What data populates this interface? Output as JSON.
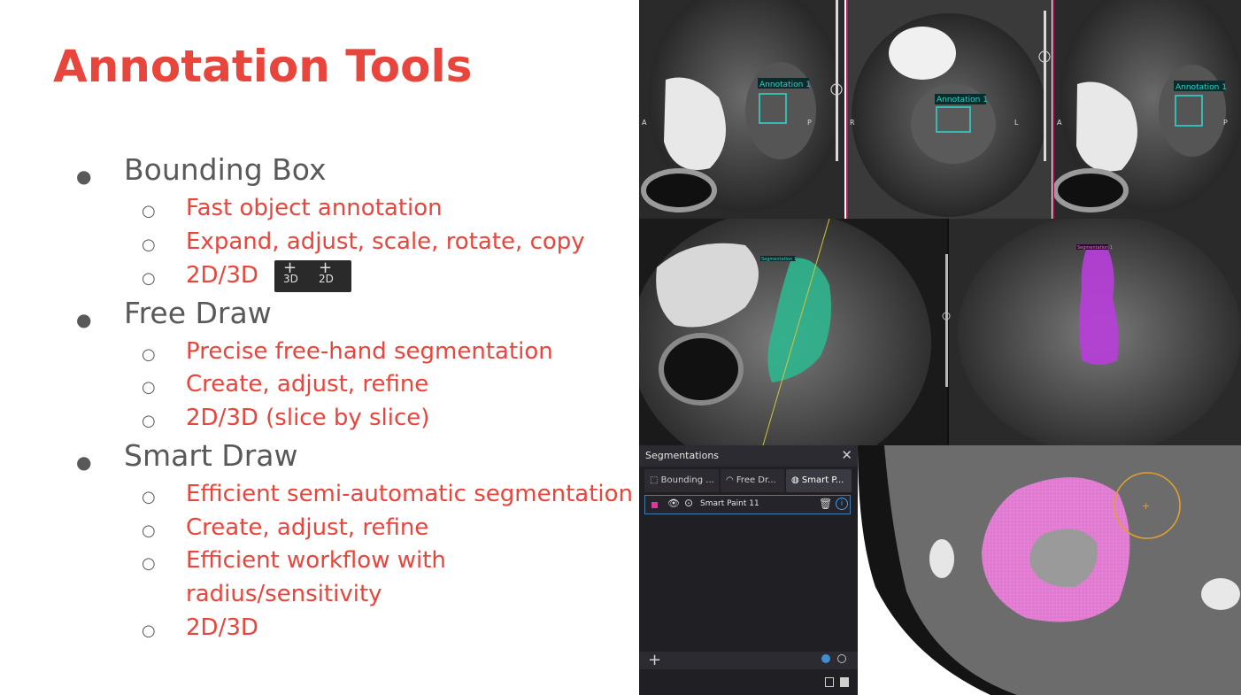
{
  "slide": {
    "title": "Annotation Tools",
    "colors": {
      "accent": "#e8453c",
      "bullet_text": "#595959",
      "teal": "#2fd3c8",
      "green_seg": "#2fb58f",
      "purple_seg": "#b63fd8",
      "pink_seg": "#e07ad0",
      "orange": "#e0a030"
    }
  },
  "bullets": [
    {
      "label": "Bounding Box",
      "subs": [
        "Fast object annotation",
        "Expand, adjust, scale, rotate, copy",
        "2D/3D"
      ]
    },
    {
      "label": "Free Draw",
      "subs": [
        "Precise free-hand segmentation",
        "Create, adjust, refine",
        "2D/3D (slice by slice)"
      ]
    },
    {
      "label": "Smart Draw",
      "subs": [
        "Efficient semi-automatic segmentation",
        "Create, adjust, refine",
        "Efficient workflow with",
        "radius/sensitivity",
        "2D/3D"
      ]
    }
  ],
  "bullet_glyphs": {
    "level1": "●",
    "level2": "○"
  },
  "bbox_buttons": [
    {
      "label": "3D",
      "icon": "plus-icon"
    },
    {
      "label": "2D",
      "icon": "plus-icon"
    }
  ],
  "mri_top": {
    "annotation_label": "Annotation 1",
    "orientation": {
      "left_a": "A",
      "left_p": "P",
      "mid_r": "R",
      "mid_l": "L",
      "right_a": "A",
      "right_p": "P"
    }
  },
  "mri_mid": {
    "left_label": "Segmentation 1",
    "right_label": "Segmentation 1"
  },
  "segmentations_panel": {
    "title": "Segmentations",
    "close_icon": "close-icon",
    "tabs": [
      {
        "label": "Bounding ...",
        "icon": "bbox-icon"
      },
      {
        "label": "Free Dr...",
        "icon": "freedraw-icon"
      },
      {
        "label": "Smart P...",
        "icon": "smartpaint-icon"
      }
    ],
    "row": {
      "name": "Smart Paint 11",
      "color": "#d63a9a",
      "icons": [
        "eye-icon",
        "location-icon",
        "trash-icon",
        "info-icon"
      ]
    },
    "footer": {
      "add_label": "+",
      "icons": [
        "visibility-on-icon",
        "visibility-off-icon",
        "save-icon",
        "save-all-icon"
      ]
    }
  }
}
